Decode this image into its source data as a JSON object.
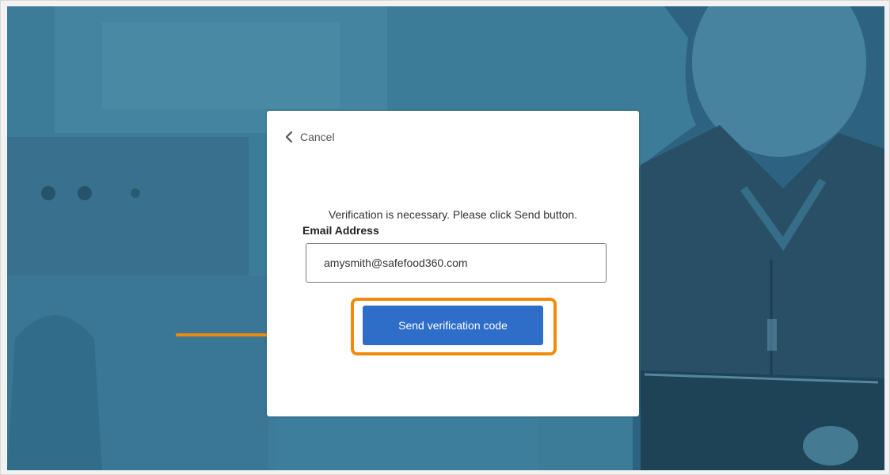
{
  "dialog": {
    "cancel_label": "Cancel",
    "intro_text": "Verification is necessary. Please click Send button.",
    "email_label": "Email Address",
    "email_value": "amysmith@safefood360.com",
    "send_button_label": "Send verification code"
  },
  "colors": {
    "background_tint": "#3b7a97",
    "button": "#2e6dc8",
    "highlight": "#f08a0c"
  },
  "icons": {
    "cancel": "chevron-left-icon",
    "annotation": "arrow-right-icon"
  }
}
